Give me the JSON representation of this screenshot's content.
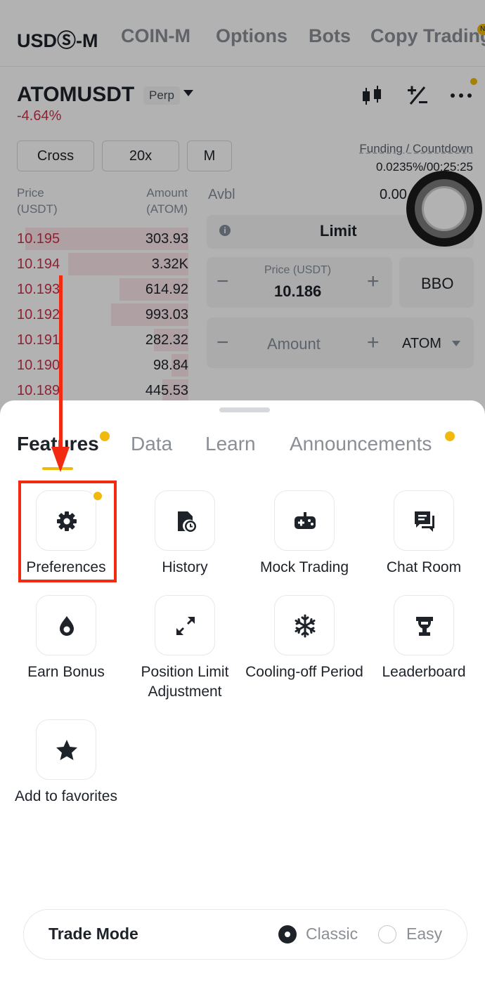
{
  "top_tabs": [
    {
      "label": "USDⓈ-M",
      "active": true
    },
    {
      "label": "COIN-M",
      "active": false
    },
    {
      "label": "Options",
      "active": false
    },
    {
      "label": "Bots",
      "active": false
    },
    {
      "label": "Copy Trading",
      "active": false
    }
  ],
  "new_badge": "N",
  "symbol": {
    "name": "ATOMUSDT",
    "type": "Perp",
    "change": "-4.64%"
  },
  "controls": {
    "margin_mode": "Cross",
    "leverage": "20x",
    "asset_mode": "M"
  },
  "funding": {
    "label": "Funding / Countdown",
    "value": "0.0235%/00:25:25"
  },
  "orderbook": {
    "price_header": [
      "Price",
      "(USDT)"
    ],
    "amount_header": [
      "Amount",
      "(ATOM)"
    ],
    "asks": [
      {
        "price": "10.195",
        "amount": "303.93",
        "depth": 0.95
      },
      {
        "price": "10.194",
        "amount": "3.32K",
        "depth": 0.7
      },
      {
        "price": "10.193",
        "amount": "614.92",
        "depth": 0.4
      },
      {
        "price": "10.192",
        "amount": "993.03",
        "depth": 0.45
      },
      {
        "price": "10.191",
        "amount": "282.32",
        "depth": 0.2
      },
      {
        "price": "10.190",
        "amount": "98.84",
        "depth": 0.1
      },
      {
        "price": "10.189",
        "amount": "445.53",
        "depth": 0.15
      }
    ]
  },
  "order_form": {
    "avbl_label": "Avbl",
    "avbl_value": "0.00",
    "order_type": "Limit",
    "price_label": "Price (USDT)",
    "price_value": "10.186",
    "bbo_label": "BBO",
    "amount_placeholder": "Amount",
    "amount_unit": "ATOM"
  },
  "sheet": {
    "tabs": [
      {
        "label": "Features",
        "active": true,
        "dot": true
      },
      {
        "label": "Data",
        "active": false,
        "dot": false
      },
      {
        "label": "Learn",
        "active": false,
        "dot": false
      },
      {
        "label": "Announcements",
        "active": false,
        "dot": true
      }
    ],
    "features": [
      {
        "label": "Preferences",
        "icon": "gear-icon",
        "dot": true
      },
      {
        "label": "History",
        "icon": "history-icon",
        "dot": false
      },
      {
        "label": "Mock Trading",
        "icon": "gamepad-icon",
        "dot": false
      },
      {
        "label": "Chat Room",
        "icon": "chat-icon",
        "dot": false
      },
      {
        "label": "Earn Bonus",
        "icon": "drop-icon",
        "dot": false
      },
      {
        "label": "Position Limit Adjustment",
        "icon": "expand-arrows-icon",
        "dot": false
      },
      {
        "label": "Cooling-off Period",
        "icon": "snowflake-icon",
        "dot": false
      },
      {
        "label": "Leaderboard",
        "icon": "trophy-icon",
        "dot": false
      },
      {
        "label": "Add to favorites",
        "icon": "star-icon",
        "dot": false
      }
    ],
    "trade_mode": {
      "label": "Trade Mode",
      "options": [
        {
          "label": "Classic",
          "selected": true
        },
        {
          "label": "Easy",
          "selected": false
        }
      ]
    }
  },
  "colors": {
    "accent": "#f0b90b",
    "sell": "#cf304a",
    "annotation": "#f22a12",
    "text": "#1e2329"
  }
}
